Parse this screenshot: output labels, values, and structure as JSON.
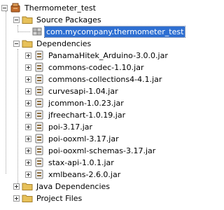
{
  "tree": {
    "root": {
      "label": "Thermometer_test",
      "icon": "project-icon"
    },
    "source_packages": {
      "label": "Source Packages",
      "icon": "folder-icon",
      "children": [
        {
          "label": "com.mycompany.thermometer_test",
          "icon": "package-icon",
          "selected": true
        }
      ]
    },
    "dependencies": {
      "label": "Dependencies",
      "icon": "folder-icon",
      "jars": [
        "PanamaHitek_Arduino-3.0.0.jar",
        "commons-codec-1.10.jar",
        "commons-collections4-4.1.jar",
        "curvesapi-1.04.jar",
        "jcommon-1.0.23.jar",
        "jfreechart-1.0.19.jar",
        "poi-3.17.jar",
        "poi-ooxml-3.17.jar",
        "poi-ooxml-schemas-3.17.jar",
        "stax-api-1.0.1.jar",
        "xmlbeans-2.6.0.jar"
      ]
    },
    "java_dependencies": {
      "label": "Java Dependencies",
      "icon": "folder-icon"
    },
    "project_files": {
      "label": "Project Files",
      "icon": "folder-icon"
    }
  },
  "colors": {
    "selection": "#2e6fd2",
    "folder": "#e7c15a",
    "jar": "#8a6a3a"
  }
}
